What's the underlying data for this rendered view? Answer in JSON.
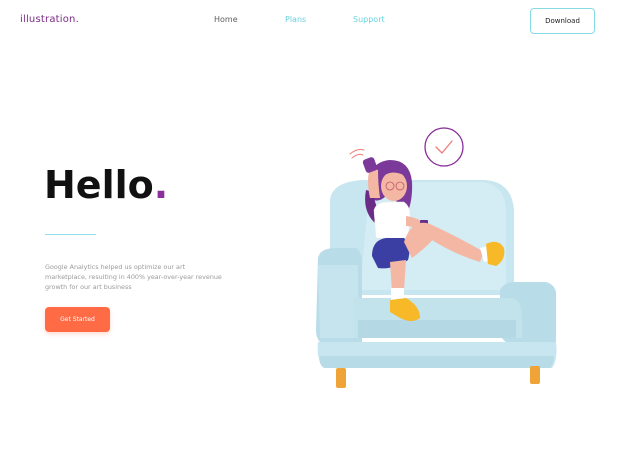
{
  "header": {
    "logo": "illustration.",
    "nav": [
      {
        "label": "Home"
      },
      {
        "label": "Plans"
      },
      {
        "label": "Support"
      }
    ],
    "download_label": "Download"
  },
  "hero": {
    "title": "Hello",
    "title_dot": ".",
    "description": "Google Analytics helped us optimize our art marketplace, resulting in 400% year-over-year revenue growth for our art business",
    "cta_label": "Get Started"
  },
  "colors": {
    "brand": "#7a2b86",
    "accent": "#6ad2e0",
    "cta": "#ff6b45"
  },
  "illustration": {
    "description": "girl-sitting-on-sofa-illustration"
  }
}
